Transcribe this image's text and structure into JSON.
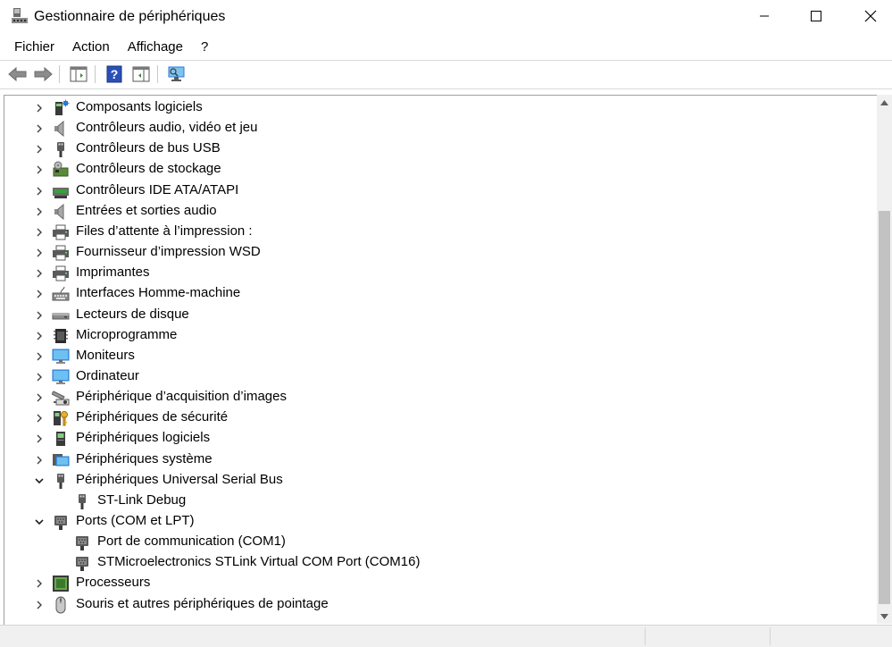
{
  "window": {
    "title": "Gestionnaire de périphériques",
    "icon": "device-manager-icon"
  },
  "menu": {
    "items": [
      "Fichier",
      "Action",
      "Affichage",
      "?"
    ]
  },
  "toolbar": {
    "buttons": [
      "back-icon",
      "forward-icon",
      "show-hide-console-tree-icon",
      "help-icon",
      "properties-icon",
      "scan-hardware-icon"
    ]
  },
  "tree": {
    "items": [
      {
        "label": "Composants logiciels",
        "level": 0,
        "expanded": false,
        "icon": "software-component-icon"
      },
      {
        "label": "Contrôleurs audio, vidéo et jeu",
        "level": 0,
        "expanded": false,
        "icon": "speaker-icon"
      },
      {
        "label": "Contrôleurs de bus USB",
        "level": 0,
        "expanded": false,
        "icon": "usb-icon"
      },
      {
        "label": "Contrôleurs de stockage",
        "level": 0,
        "expanded": false,
        "icon": "storage-controller-icon"
      },
      {
        "label": "Contrôleurs IDE ATA/ATAPI",
        "level": 0,
        "expanded": false,
        "icon": "ide-controller-icon"
      },
      {
        "label": "Entrées et sorties audio",
        "level": 0,
        "expanded": false,
        "icon": "speaker-icon"
      },
      {
        "label": "Files d’attente à l’impression :",
        "level": 0,
        "expanded": false,
        "icon": "printer-icon"
      },
      {
        "label": "Fournisseur d’impression WSD",
        "level": 0,
        "expanded": false,
        "icon": "printer-icon"
      },
      {
        "label": "Imprimantes",
        "level": 0,
        "expanded": false,
        "icon": "printer-icon"
      },
      {
        "label": "Interfaces Homme-machine",
        "level": 0,
        "expanded": false,
        "icon": "hid-icon"
      },
      {
        "label": "Lecteurs de disque",
        "level": 0,
        "expanded": false,
        "icon": "disk-drive-icon"
      },
      {
        "label": "Microprogramme",
        "level": 0,
        "expanded": false,
        "icon": "firmware-icon"
      },
      {
        "label": "Moniteurs",
        "level": 0,
        "expanded": false,
        "icon": "monitor-icon"
      },
      {
        "label": "Ordinateur",
        "level": 0,
        "expanded": false,
        "icon": "monitor-icon"
      },
      {
        "label": "Périphérique d’acquisition d’images",
        "level": 0,
        "expanded": false,
        "icon": "camera-icon"
      },
      {
        "label": "Périphériques de sécurité",
        "level": 0,
        "expanded": false,
        "icon": "security-key-icon"
      },
      {
        "label": "Périphériques logiciels",
        "level": 0,
        "expanded": false,
        "icon": "software-device-icon"
      },
      {
        "label": "Périphériques système",
        "level": 0,
        "expanded": false,
        "icon": "system-device-icon"
      },
      {
        "label": "Périphériques Universal Serial Bus",
        "level": 0,
        "expanded": true,
        "icon": "usb-icon"
      },
      {
        "label": "ST-Link Debug",
        "level": 1,
        "expanded": null,
        "icon": "usb-icon"
      },
      {
        "label": "Ports (COM et LPT)",
        "level": 0,
        "expanded": true,
        "icon": "port-icon"
      },
      {
        "label": "Port de communication (COM1)",
        "level": 1,
        "expanded": null,
        "icon": "port-icon"
      },
      {
        "label": "STMicroelectronics STLink Virtual COM Port (COM16)",
        "level": 1,
        "expanded": null,
        "icon": "port-icon"
      },
      {
        "label": "Processeurs",
        "level": 0,
        "expanded": false,
        "icon": "processor-icon"
      },
      {
        "label": "Souris et autres périphériques de pointage",
        "level": 0,
        "expanded": false,
        "icon": "mouse-icon"
      }
    ]
  },
  "colors": {
    "accent_blue": "#2b79d6",
    "icon_gray": "#5a5a5a",
    "chevron": "#404040"
  }
}
